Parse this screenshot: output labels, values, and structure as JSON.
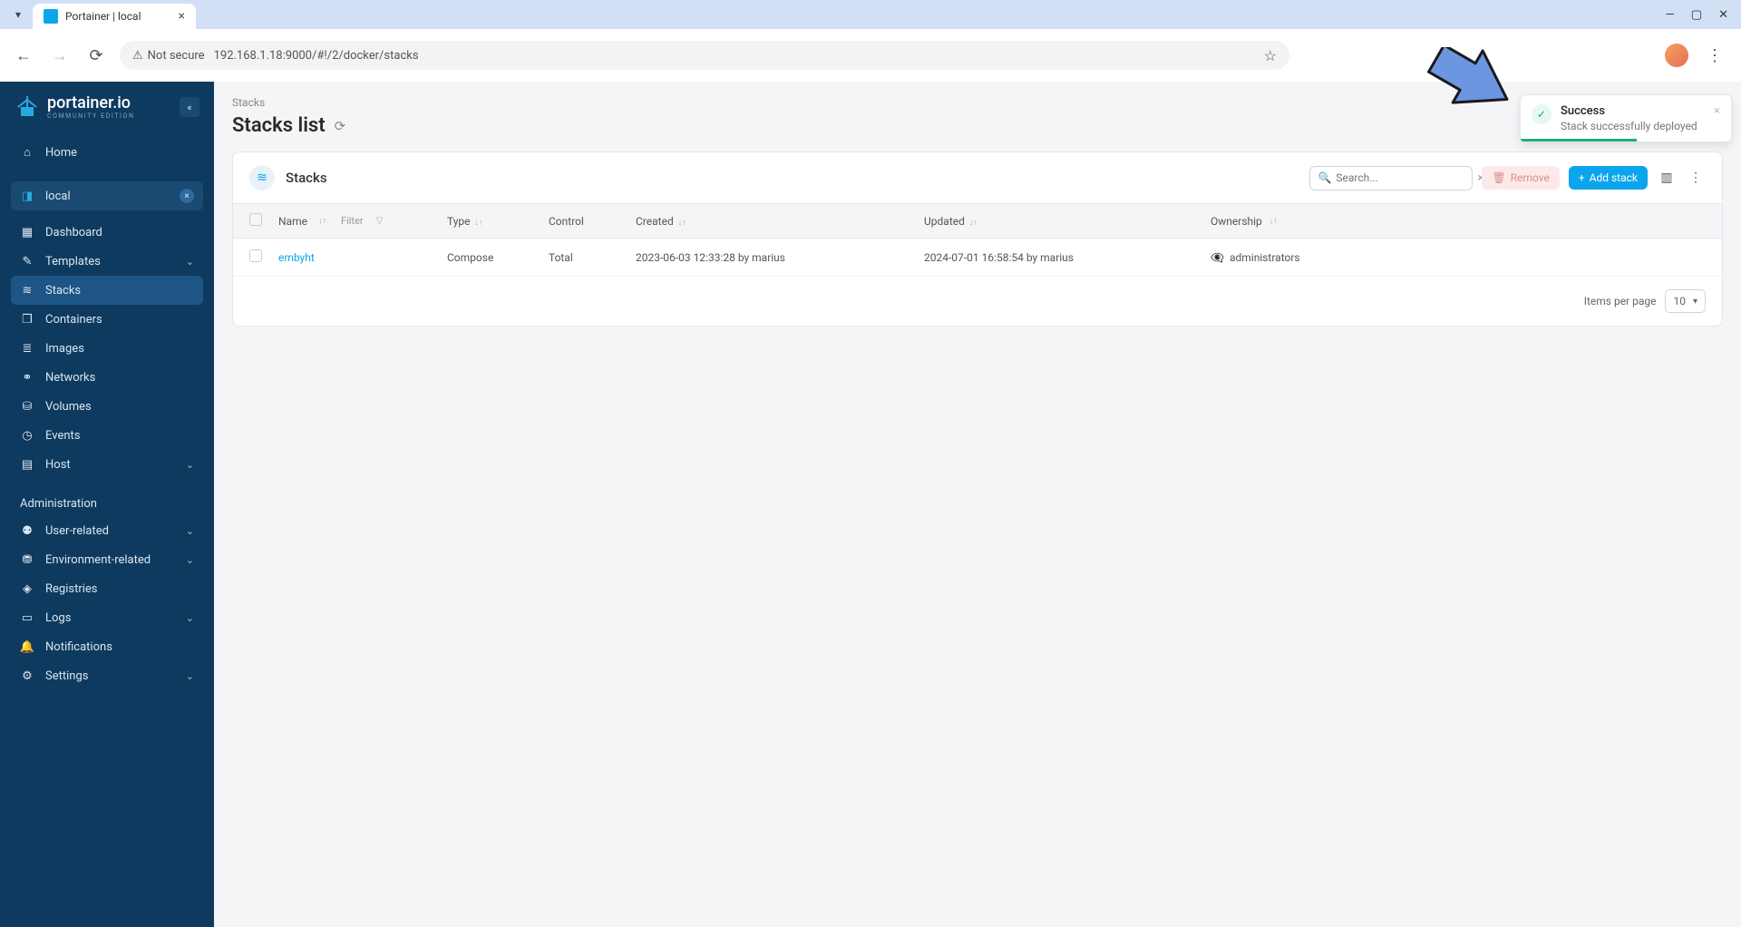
{
  "browser": {
    "tab_title": "Portainer | local",
    "security_label": "Not secure",
    "url": "192.168.1.18:9000/#!/2/docker/stacks"
  },
  "sidebar": {
    "logo_main": "portainer.io",
    "logo_sub": "COMMUNITY EDITION",
    "home": "Home",
    "env_name": "local",
    "items": {
      "dashboard": "Dashboard",
      "templates": "Templates",
      "stacks": "Stacks",
      "containers": "Containers",
      "images": "Images",
      "networks": "Networks",
      "volumes": "Volumes",
      "events": "Events",
      "host": "Host"
    },
    "admin_heading": "Administration",
    "admin": {
      "user_related": "User-related",
      "env_related": "Environment-related",
      "registries": "Registries",
      "logs": "Logs",
      "notifications": "Notifications",
      "settings": "Settings"
    }
  },
  "main": {
    "breadcrumb": "Stacks",
    "page_title": "Stacks list",
    "card_title": "Stacks",
    "search_placeholder": "Search...",
    "remove_label": "Remove",
    "add_label": "Add stack",
    "columns": {
      "name": "Name",
      "filter": "Filter",
      "type": "Type",
      "control": "Control",
      "created": "Created",
      "updated": "Updated",
      "ownership": "Ownership"
    },
    "rows": [
      {
        "name": "embyht",
        "type": "Compose",
        "control": "Total",
        "created": "2023-06-03 12:33:28 by marius",
        "updated": "2024-07-01 16:58:54 by marius",
        "ownership": "administrators"
      }
    ],
    "items_per_page_label": "Items per page",
    "items_per_page_value": "10"
  },
  "toast": {
    "title": "Success",
    "message": "Stack successfully deployed"
  }
}
